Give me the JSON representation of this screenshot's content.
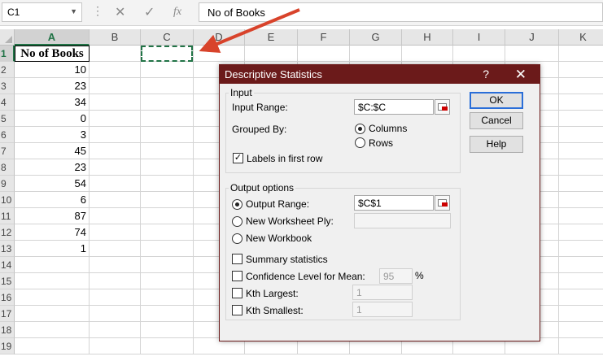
{
  "formula_bar": {
    "name_box": "C1",
    "cancel_glyph": "✕",
    "enter_glyph": "✓",
    "function_label": "fx",
    "content": "No of Books"
  },
  "columns": [
    "A",
    "B",
    "C",
    "D",
    "E",
    "F",
    "G",
    "H",
    "I",
    "J",
    "K"
  ],
  "selected_column": "A",
  "rows": [
    "1",
    "2",
    "3",
    "4",
    "5",
    "6",
    "7",
    "8",
    "9",
    "10",
    "11",
    "12",
    "13",
    "14",
    "15",
    "16",
    "17",
    "18",
    "19"
  ],
  "selected_row": "1",
  "cells": {
    "A1": "No of Books",
    "A2": "10",
    "A3": "23",
    "A4": "34",
    "A5": "0",
    "A6": "3",
    "A7": "45",
    "A8": "23",
    "A9": "54",
    "A10": "6",
    "A11": "87",
    "A12": "74",
    "A13": "1"
  },
  "dialog": {
    "title": "Descriptive Statistics",
    "help": "?",
    "close": "✕",
    "input_group": "Input",
    "input_range_label": "Input Range:",
    "input_range_value": "$C:$C",
    "grouped_by_label": "Grouped By:",
    "columns_option": "Columns",
    "rows_option": "Rows",
    "labels_first_row": "Labels in first row",
    "output_group": "Output options",
    "output_range_label": "Output Range:",
    "output_range_value": "$C$1",
    "new_worksheet_label": "New Worksheet Ply:",
    "new_workbook_label": "New Workbook",
    "summary_stats": "Summary statistics",
    "confidence_label": "Confidence Level for Mean:",
    "confidence_value": "95",
    "percent": "%",
    "kth_largest_label": "Kth Largest:",
    "kth_largest_value": "1",
    "kth_smallest_label": "Kth Smallest:",
    "kth_smallest_value": "1",
    "ok": "OK",
    "cancel": "Cancel",
    "help_button": "Help"
  },
  "colors": {
    "dialog_title_bar": "#6b1a1a",
    "annotation_arrow": "#d8432b",
    "selection_green": "#217346"
  }
}
